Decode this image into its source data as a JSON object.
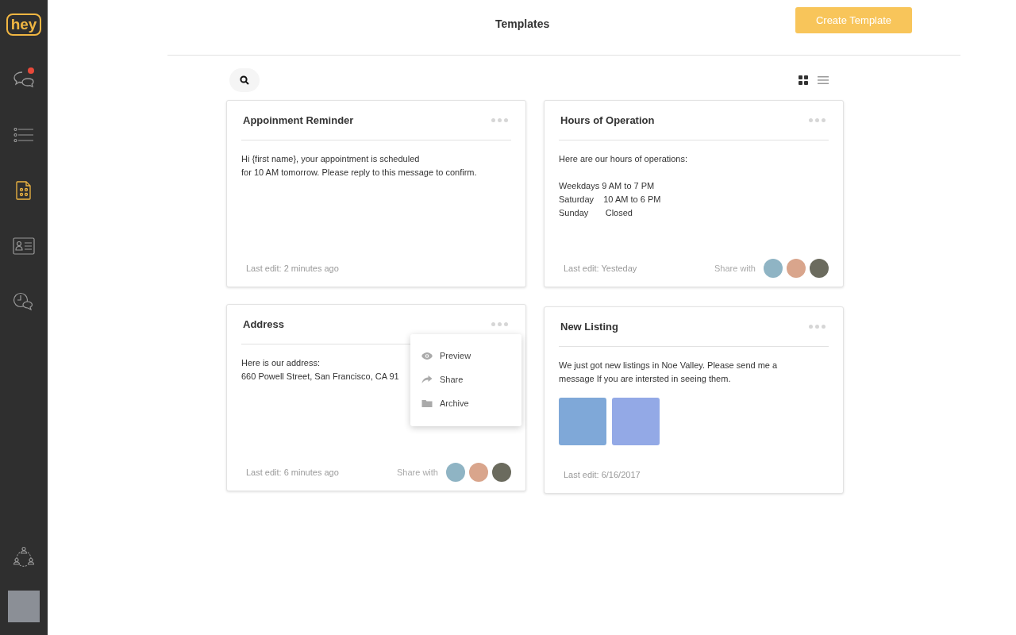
{
  "sidebar": {
    "logo": "hey",
    "items": [
      {
        "kind": "chat",
        "selected": false,
        "badge": true
      },
      {
        "kind": "list",
        "selected": false,
        "badge": false
      },
      {
        "kind": "templates",
        "selected": true,
        "badge": false
      },
      {
        "kind": "contacts",
        "selected": false,
        "badge": false
      },
      {
        "kind": "history",
        "selected": false,
        "badge": false
      }
    ],
    "bottom_items": [
      {
        "kind": "team",
        "selected": false,
        "badge": false
      }
    ]
  },
  "header": {
    "title": "Templates",
    "create_button": "Create Template"
  },
  "toolbar": {
    "view_modes": [
      {
        "kind": "grid",
        "selected": true
      },
      {
        "kind": "list",
        "selected": false
      }
    ]
  },
  "cards": [
    {
      "title": "Appoinment Reminder",
      "body": "Hi {first name}, your appointment is scheduled\nfor 10 AM tomorrow. Please reply to this message to confirm.",
      "last_edit": "Last edit: 2 minutes ago"
    },
    {
      "title": "Hours of Operation",
      "body": "Here are our hours of operations:\n\nWeekdays 9 AM to 7 PM\nSaturday    10 AM to 6 PM\nSunday       Closed",
      "last_edit": "Last edit: Yesteday",
      "share_label": "Share with",
      "shared_with": [
        {
          "color": "#8fb4c4"
        },
        {
          "color": "#d9a58c"
        },
        {
          "color": "#6b6b5e"
        }
      ]
    },
    {
      "title": "Address",
      "body": "Here is our address:\n660 Powell Street, San Francisco, CA 91",
      "last_edit": "Last edit: 6 minutes ago",
      "share_label": "Share with",
      "shared_with": [
        {
          "color": "#8fb4c4"
        },
        {
          "color": "#d9a58c"
        },
        {
          "color": "#6b6b5e"
        }
      ],
      "menu": {
        "open": true,
        "items": [
          {
            "kind": "preview",
            "label": "Preview"
          },
          {
            "kind": "share",
            "label": "Share"
          },
          {
            "kind": "archive",
            "label": "Archive"
          }
        ]
      }
    },
    {
      "title": "New Listing",
      "body": "We just got new listings in Noe Valley. Please send me a\nmessage If you are intersted in seeing them.",
      "last_edit": "Last edit: 6/16/2017",
      "photos": [
        {
          "color": "#7fa8d8"
        },
        {
          "color": "#93a9e6"
        }
      ]
    }
  ]
}
